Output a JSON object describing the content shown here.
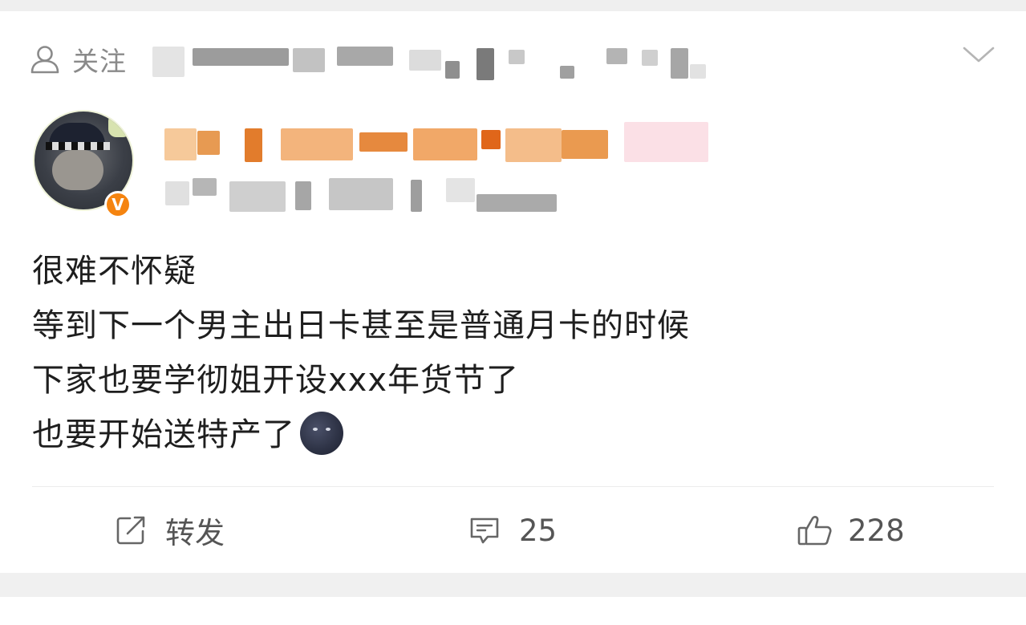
{
  "follow": {
    "label": "关注"
  },
  "post": {
    "lines": [
      "很难不怀疑",
      "等到下一个男主出日卡甚至是普通月卡的时候",
      "下家也要学彻姐开设xxx年货节了",
      "也要开始送特产了"
    ],
    "emoji": "new-moon-face"
  },
  "actions": {
    "repost_label": "转发",
    "comment_count": "25",
    "like_count": "228"
  },
  "colors": {
    "verified_badge": "#f58410",
    "blur_username": "#f0a060",
    "blur_gray": "#b0b0b0"
  }
}
